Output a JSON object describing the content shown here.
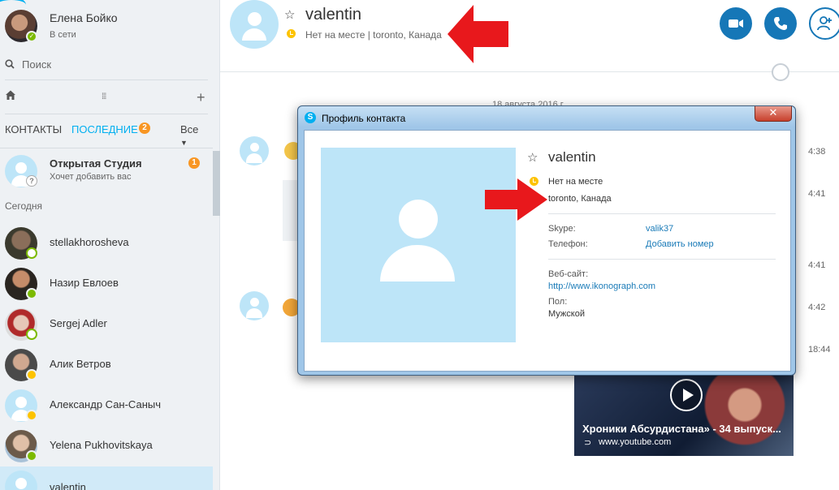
{
  "me": {
    "name": "Елена Бойко",
    "status": "В сети"
  },
  "search": {
    "label": "Поиск"
  },
  "tabs": {
    "contacts": "КОНТАКТЫ",
    "recent": "ПОСЛЕДНИЕ",
    "recent_count": "2",
    "filter": "Все"
  },
  "list": {
    "pending": {
      "name": "Открытая Студия",
      "sub": "Хочет добавить вас",
      "count": "1"
    },
    "today_label": "Сегодня",
    "contacts": [
      {
        "name": "stellakhorosheva"
      },
      {
        "name": "Назир Евлоев"
      },
      {
        "name": "Sergej Adler"
      },
      {
        "name": "Алик Ветров"
      },
      {
        "name": "Александр Сан-Саныч"
      },
      {
        "name": "Yelena  Pukhovitskaya"
      },
      {
        "name": "valentin"
      }
    ]
  },
  "header": {
    "name": "valentin",
    "status": "Нет на месте  |  toronto, Канада"
  },
  "chat": {
    "date": "18 августа 2016 г.",
    "times": [
      "4:38",
      "4:41",
      "4:41",
      "4:42",
      "18:44"
    ],
    "video": {
      "title": "Хроники Абсурдистана» - 34 выпуск...",
      "url": "www.youtube.com"
    }
  },
  "dialog": {
    "title": "Профиль контакта",
    "close": "✕",
    "name": "valentin",
    "status": "Нет на месте",
    "location": "toronto, Канада",
    "skype_label": "Skype:",
    "skype_value": "valik37",
    "phone_label": "Телефон:",
    "phone_value": "Добавить номер",
    "website_label": "Веб-сайт:",
    "website_value": "http://www.ikonograph.com",
    "gender_label": "Пол:",
    "gender_value": "Мужской"
  },
  "colors": {
    "accent": "#00aff0",
    "call_button": "#1677b7",
    "away": "#fdc300",
    "online": "#7cba00",
    "arrow": "#e8181c"
  }
}
